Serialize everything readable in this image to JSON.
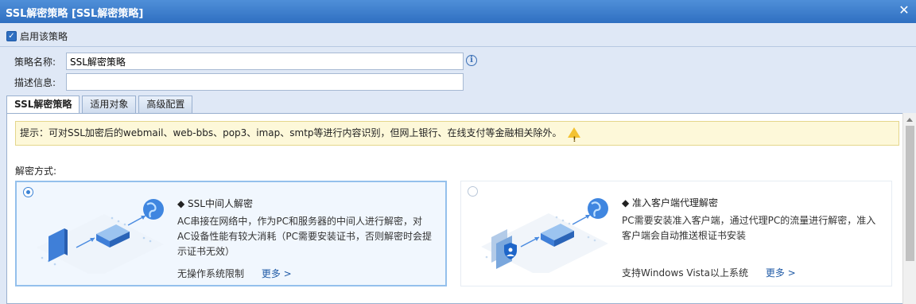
{
  "window": {
    "title": "SSL解密策略 [SSL解密策略]",
    "close_glyph": "✕"
  },
  "enable": {
    "label": "启用该策略",
    "checked": true
  },
  "form": {
    "name_label": "策略名称:",
    "name_value": "SSL解密策略",
    "desc_label": "描述信息:",
    "desc_value": ""
  },
  "tabs": [
    {
      "label": "SSL解密策略",
      "active": true
    },
    {
      "label": "适用对象",
      "active": false
    },
    {
      "label": "高级配置",
      "active": false
    }
  ],
  "notice": {
    "text": "提示：可对SSL加密后的webmail、web-bbs、pop3、imap、smtp等进行内容识别，但网上银行、在线支付等金融相关除外。"
  },
  "method": {
    "label": "解密方式:",
    "options": [
      {
        "title": "◆ SSL中间人解密",
        "desc": "AC串接在网络中，作为PC和服务器的中间人进行解密，对AC设备性能有较大消耗（PC需要安装证书，否则解密时会提示证书无效）",
        "footer": "无操作系统限制",
        "more": "更多 >",
        "selected": true
      },
      {
        "title": "◆ 准入客户端代理解密",
        "desc": "PC需要安装准入客户端，通过代理PC的流量进行解密，准入客户端会自动推送根证书安装",
        "footer": "支持Windows Vista以上系统",
        "more": "更多 >",
        "selected": false
      }
    ]
  },
  "colors": {
    "titlebar": "#2f6fc1",
    "accent": "#3b83d6",
    "notice_bg": "#fdf8d9",
    "selected_card_bg": "#f1f7fe"
  },
  "icons": {
    "close": "close-icon",
    "info": "info-icon",
    "warning": "warning-icon",
    "checkbox": "checkbox-checked-icon"
  }
}
